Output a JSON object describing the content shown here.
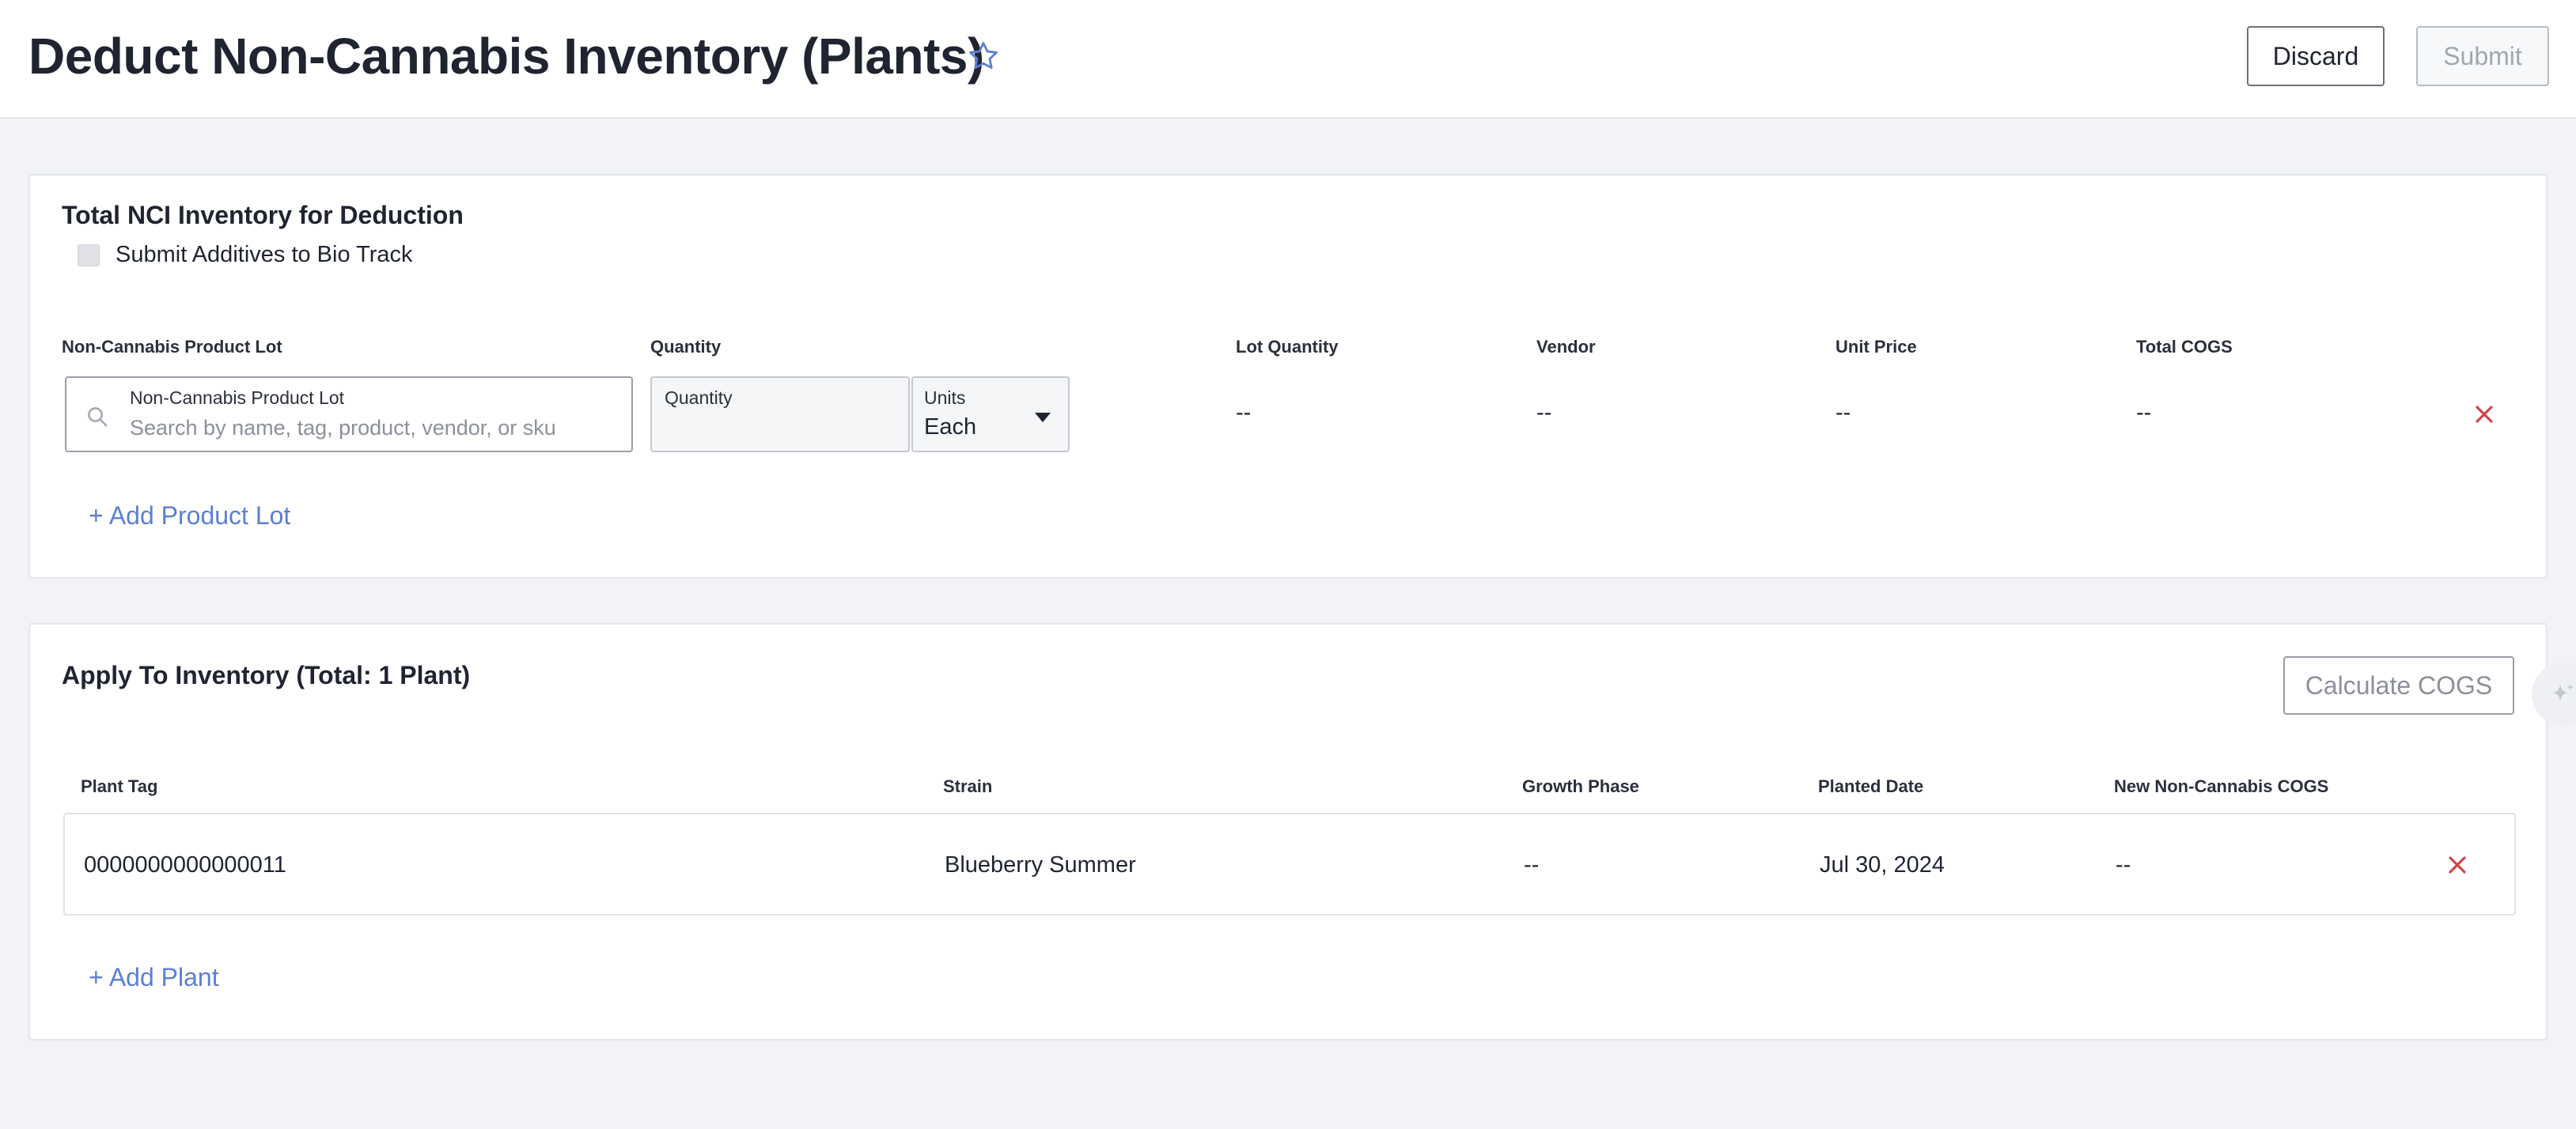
{
  "header": {
    "title": "Deduct Non-Cannabis Inventory (Plants)",
    "favorite_icon": "star-outline-icon",
    "discard_label": "Discard",
    "submit_label": "Submit"
  },
  "nci_section": {
    "title": "Total NCI Inventory for Deduction",
    "checkbox_label": "Submit Additives to Bio Track",
    "checkbox_checked": false,
    "columns": {
      "product_lot": "Non-Cannabis Product Lot",
      "quantity": "Quantity",
      "lot_quantity": "Lot Quantity",
      "vendor": "Vendor",
      "unit_price": "Unit Price",
      "total_cogs": "Total COGS"
    },
    "row": {
      "lot_field_label": "Non-Cannabis Product Lot",
      "lot_field_placeholder": "Search by name, tag, product, vendor, or sku",
      "quantity_field_label": "Quantity",
      "quantity_value": "",
      "units_label": "Units",
      "units_value": "Each",
      "lot_quantity": "--",
      "vendor": "--",
      "unit_price": "--",
      "total_cogs": "--"
    },
    "add_link": "+ Add Product Lot"
  },
  "apply_section": {
    "title": "Apply To Inventory (Total: 1 Plant)",
    "calculate_label": "Calculate COGS",
    "columns": {
      "plant_tag": "Plant Tag",
      "strain": "Strain",
      "growth_phase": "Growth Phase",
      "planted_date": "Planted Date",
      "new_cogs": "New Non-Cannabis COGS"
    },
    "rows": [
      {
        "plant_tag": "0000000000000011",
        "strain": "Blueberry Summer",
        "growth_phase": "--",
        "planted_date": "Jul 30, 2024",
        "new_cogs": "--"
      }
    ],
    "add_link": "+ Add Plant"
  },
  "colors": {
    "accent_link": "#5c7fd1",
    "remove_red": "#d0454c",
    "page_background": "#f2f3f6"
  }
}
